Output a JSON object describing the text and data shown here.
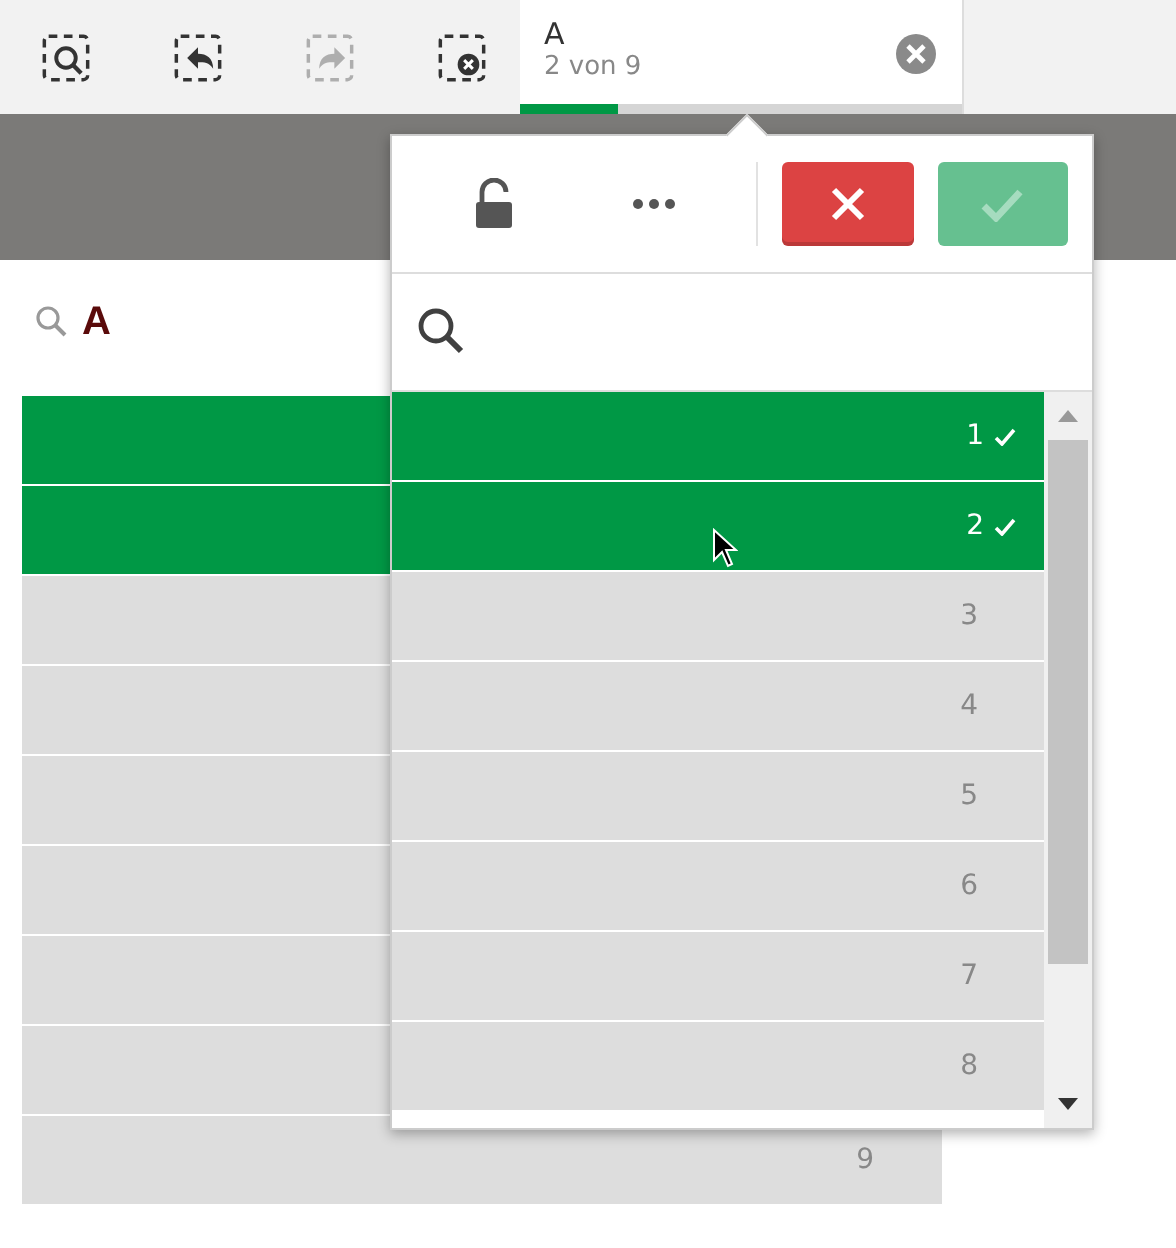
{
  "toolbar": {
    "buttons": [
      {
        "kind": "search",
        "disabled": false
      },
      {
        "kind": "back",
        "disabled": false
      },
      {
        "kind": "forward",
        "disabled": true
      },
      {
        "kind": "clear",
        "disabled": false
      }
    ]
  },
  "selection_tab": {
    "field": "A",
    "count": "2 von 9",
    "level": 0.22
  },
  "filter_pane": {
    "title": "A",
    "rows": [
      {
        "selected": true
      },
      {
        "selected": true
      },
      {
        "selected": false
      },
      {
        "selected": false
      },
      {
        "selected": false
      },
      {
        "selected": false
      },
      {
        "selected": false
      },
      {
        "selected": false
      },
      {
        "label": "9",
        "selected": false
      }
    ]
  },
  "popover": {
    "locked": false,
    "items": [
      {
        "label": "1",
        "selected": true
      },
      {
        "label": "2",
        "selected": true
      },
      {
        "label": "3",
        "selected": false
      },
      {
        "label": "4",
        "selected": false
      },
      {
        "label": "5",
        "selected": false
      },
      {
        "label": "6",
        "selected": false
      },
      {
        "label": "7",
        "selected": false
      },
      {
        "label": "8",
        "selected": false
      }
    ]
  }
}
